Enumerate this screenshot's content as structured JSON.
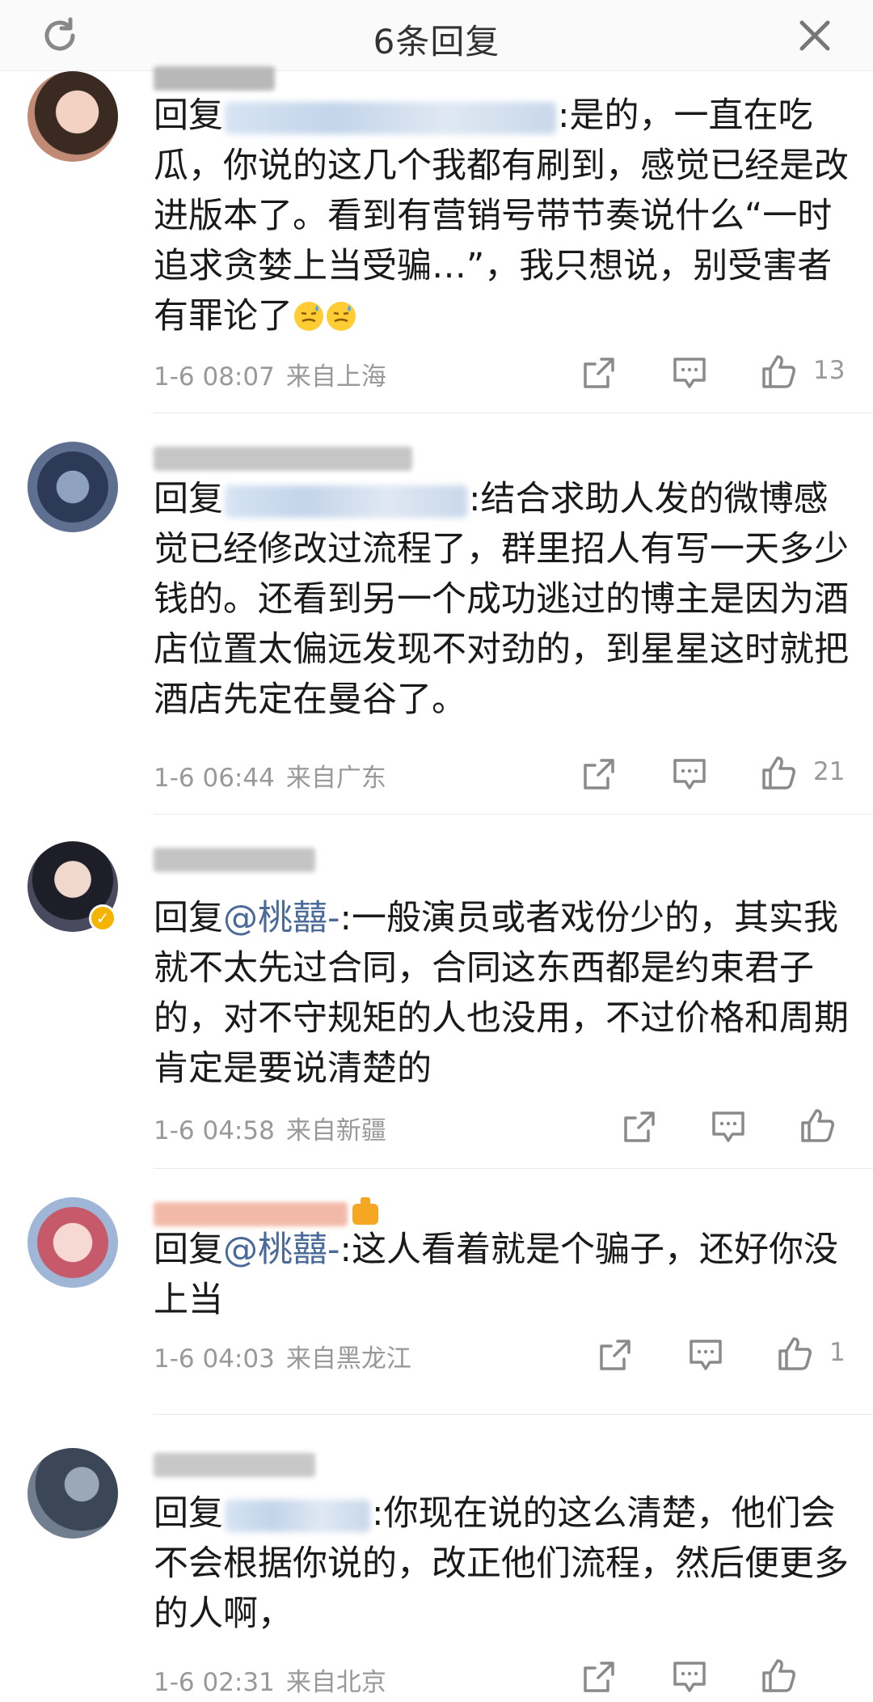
{
  "header": {
    "title": "6条回复"
  },
  "comments": [
    {
      "text_before": "回复",
      "text_after": ":是的，一直在吃瓜，你说的这几个我都有刷到，感觉已经是改进版本了。看到有营销号带节奏说什么“一时追求贪婪上当受骗…”，我只想说，别受害者有罪论了",
      "time": "1-6 08:07",
      "location": "来自上海",
      "likes": "13"
    },
    {
      "text_before": "回复",
      "text_after": ":结合求助人发的微博感觉已经修改过流程了，群里招人有写一天多少钱的。还看到另一个成功逃过的博主是因为酒店位置太偏远发现不对劲的，到星星这时就把酒店先定在曼谷了。",
      "time": "1-6 06:44",
      "location": "来自广东",
      "likes": "21"
    },
    {
      "text_before": "回复",
      "mention": "@桃囍-",
      "text_after": ":一般演员或者戏份少的，其实我就不太先过合同，合同这东西都是约束君子的，对不守规矩的人也没用，不过价格和周期肯定是要说清楚的",
      "time": "1-6 04:58",
      "location": "来自新疆",
      "likes": ""
    },
    {
      "text_before": "回复",
      "mention": "@桃囍-",
      "text_after": ":这人看着就是个骗子，还好你没上当",
      "time": "1-6 04:03",
      "location": "来自黑龙江",
      "likes": "1"
    },
    {
      "text_before": "回复",
      "text_after": ":你现在说的这么清楚，他们会不会根据你说的，改正他们流程，然后便更多的人啊，",
      "time": "1-6 02:31",
      "location": "来自北京",
      "likes": ""
    }
  ],
  "icons": [
    "refresh-icon",
    "close-icon",
    "share-icon",
    "comment-icon",
    "like-icon",
    "verified-badge-icon"
  ],
  "colors": {
    "text": "#1a1a1a",
    "meta": "#999999",
    "mention": "#4a6a9a",
    "badge": "#f5b400"
  }
}
